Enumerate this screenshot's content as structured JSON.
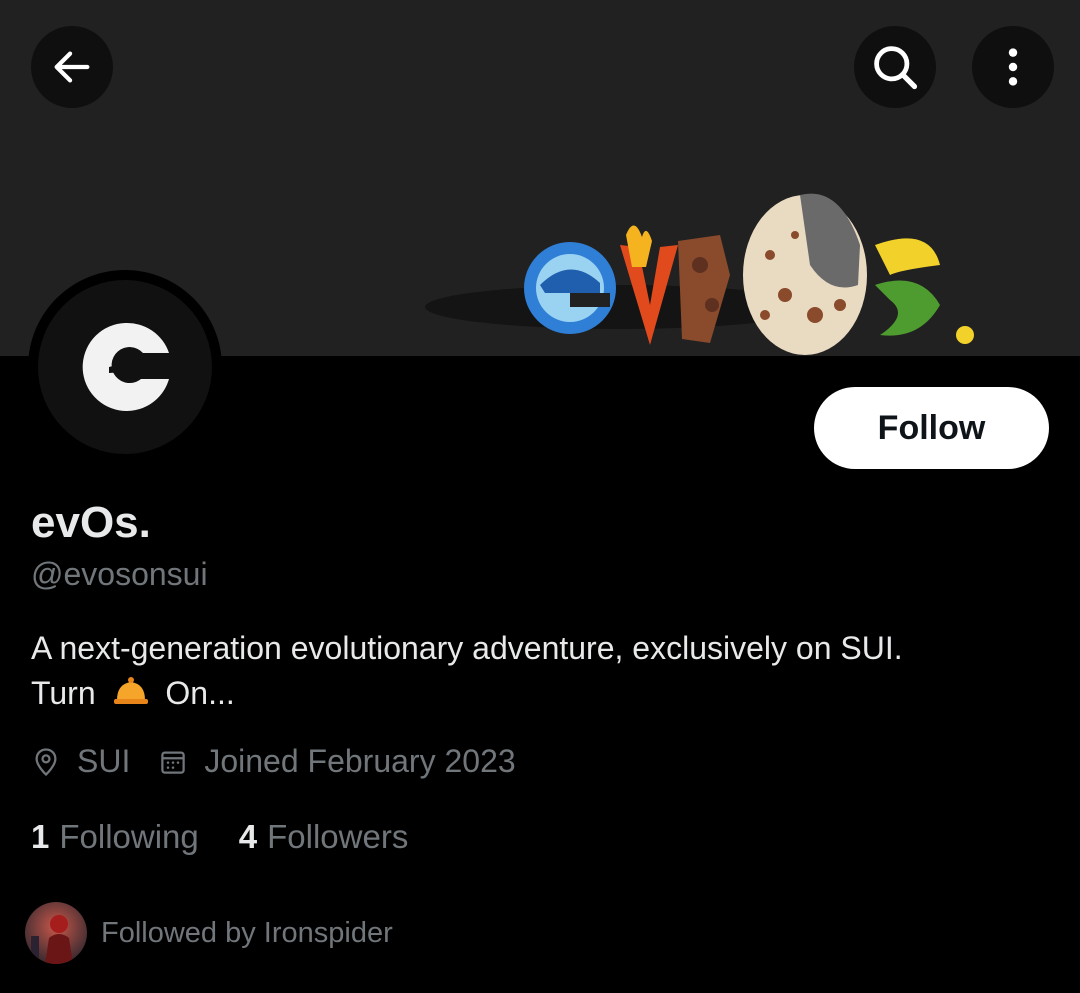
{
  "header": {
    "back_icon": "arrow-left-icon",
    "search_icon": "search-icon",
    "more_icon": "more-vertical-icon"
  },
  "banner": {
    "logo_text": "evOs."
  },
  "profile": {
    "display_name": "evOs.",
    "handle": "@evosonsui",
    "bio_line1": "A next-generation evolutionary adventure, exclusively on SUI.",
    "bio_line2_start": "Turn",
    "bio_emoji": "bell-icon",
    "bio_line2_end": "On...",
    "location": "SUI",
    "joined": "Joined February 2023",
    "follow_label": "Follow"
  },
  "stats": {
    "following_count": "1",
    "following_label": "Following",
    "followers_count": "4",
    "followers_label": "Followers"
  },
  "followed_by": {
    "text": "Followed by Ironspider"
  },
  "colors": {
    "background": "#000000",
    "banner": "#212121",
    "text_primary": "#e7e9ea",
    "text_secondary": "#71767b",
    "follow_bg": "#ffffff"
  }
}
